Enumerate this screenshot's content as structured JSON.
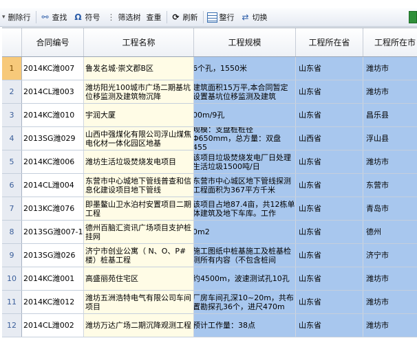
{
  "toolbar": {
    "items": [
      {
        "label": "删除行",
        "icon": "dropdown-grip-icon"
      },
      {
        "label": "查找",
        "icon": "binoculars-icon"
      },
      {
        "label": "符号",
        "icon": "omega-icon"
      },
      {
        "label": "筛选树",
        "icon": "tree-filter-icon"
      },
      {
        "label": "查重",
        "icon": ""
      },
      {
        "label": "刷新",
        "icon": "refresh-icon"
      },
      {
        "label": "整行",
        "icon": "grid-icon"
      },
      {
        "label": "切换",
        "icon": "switch-icon"
      }
    ]
  },
  "table": {
    "headers": [
      "合同编号",
      "工程名称",
      "工程规模",
      "工程所在省",
      "工程所在市"
    ],
    "rows": [
      {
        "num": "1",
        "id": "2014KC潍007",
        "name": "鲁发名城·崇文郡B区",
        "scale": "6个孔，1550米",
        "province": "山东省",
        "city": "潍坊市"
      },
      {
        "num": "2",
        "id": "2014CL潍003",
        "name": "潍坊阳光100城市广场二期基坑位移监测及建筑物沉降",
        "scale": "建筑面积15万平,本合同暂定设置基坑位移监测及建筑",
        "province": "山东省",
        "city": "潍坊市"
      },
      {
        "num": "3",
        "id": "2014KC潍010",
        "name": "宇润大厦",
        "scale": "00m/9孔",
        "province": "山东省",
        "city": "昌乐县"
      },
      {
        "num": "4",
        "id": "2013SG潍029",
        "name": "山西中强煤化有限公司浮山煤焦电化材一体化园区地基",
        "scale": "规模：支盘桩桩径Φ650mm，总方量：双盘455",
        "province": "山西省",
        "city": "浮山县"
      },
      {
        "num": "5",
        "id": "2014KC潍006",
        "name": "潍坊生活垃圾焚烧发电项目",
        "scale": "该项目垃圾焚烧发电厂日处理生活垃圾1500吨/日",
        "province": "山东省",
        "city": "潍坊市"
      },
      {
        "num": "6",
        "id": "2014CL潍004",
        "name": "东营市中心城地下管线普查和信息化建设项目地下管线",
        "scale": "东营市中心城区地下管线探测工程面积为367平方千米",
        "province": "山东省",
        "city": "东营市"
      },
      {
        "num": "7",
        "id": "2013KC潍076",
        "name": "即墨鳌山卫水泊村安置项目二期工程",
        "scale": "该项目占地87.4亩，共12栋单体建筑及地下车库。工作",
        "province": "山东省",
        "city": "青岛市"
      },
      {
        "num": "8",
        "id": "2013SG潍007-1",
        "name": "德州百脑汇资讯广场项目支护桩挂网",
        "scale": "0m2",
        "province": "山东省",
        "city": "德州"
      },
      {
        "num": "9",
        "id": "2013SG潍026",
        "name": "济宁市创业公寓（ N、O、P#楼）桩基工程",
        "scale": "施工图纸中桩基施工及桩基检测所有内容（不包含桩间",
        "province": "山东省",
        "city": "济宁市"
      },
      {
        "num": "10",
        "id": "2014KC潍001",
        "name": "高盛丽苑住宅区",
        "scale": "约4500m，波速测试孔10孔",
        "province": "山东省",
        "city": "潍坊市"
      },
      {
        "num": "11",
        "id": "2014KC潍012",
        "name": "潍坊五洲浩特电气有限公司车间项目",
        "scale": "厂房车间孔深10~20m，共布置勘探孔36个，进尺470m",
        "province": "山东省",
        "city": "潍坊市"
      },
      {
        "num": "12",
        "id": "2014CL潍002",
        "name": "潍坊万达广场二期沉降观测工程",
        "scale": "预计工作量：38点",
        "province": "山东省",
        "city": "潍坊市"
      }
    ]
  }
}
